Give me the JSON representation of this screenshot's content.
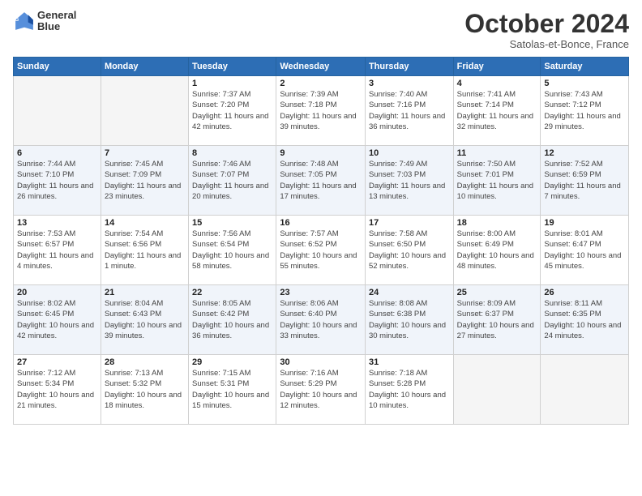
{
  "logo": {
    "line1": "General",
    "line2": "Blue"
  },
  "title": "October 2024",
  "location": "Satolas-et-Bonce, France",
  "headers": [
    "Sunday",
    "Monday",
    "Tuesday",
    "Wednesday",
    "Thursday",
    "Friday",
    "Saturday"
  ],
  "weeks": [
    [
      {
        "day": "",
        "empty": true
      },
      {
        "day": "",
        "empty": true
      },
      {
        "day": "1",
        "sunrise": "Sunrise: 7:37 AM",
        "sunset": "Sunset: 7:20 PM",
        "daylight": "Daylight: 11 hours and 42 minutes."
      },
      {
        "day": "2",
        "sunrise": "Sunrise: 7:39 AM",
        "sunset": "Sunset: 7:18 PM",
        "daylight": "Daylight: 11 hours and 39 minutes."
      },
      {
        "day": "3",
        "sunrise": "Sunrise: 7:40 AM",
        "sunset": "Sunset: 7:16 PM",
        "daylight": "Daylight: 11 hours and 36 minutes."
      },
      {
        "day": "4",
        "sunrise": "Sunrise: 7:41 AM",
        "sunset": "Sunset: 7:14 PM",
        "daylight": "Daylight: 11 hours and 32 minutes."
      },
      {
        "day": "5",
        "sunrise": "Sunrise: 7:43 AM",
        "sunset": "Sunset: 7:12 PM",
        "daylight": "Daylight: 11 hours and 29 minutes."
      }
    ],
    [
      {
        "day": "6",
        "sunrise": "Sunrise: 7:44 AM",
        "sunset": "Sunset: 7:10 PM",
        "daylight": "Daylight: 11 hours and 26 minutes."
      },
      {
        "day": "7",
        "sunrise": "Sunrise: 7:45 AM",
        "sunset": "Sunset: 7:09 PM",
        "daylight": "Daylight: 11 hours and 23 minutes."
      },
      {
        "day": "8",
        "sunrise": "Sunrise: 7:46 AM",
        "sunset": "Sunset: 7:07 PM",
        "daylight": "Daylight: 11 hours and 20 minutes."
      },
      {
        "day": "9",
        "sunrise": "Sunrise: 7:48 AM",
        "sunset": "Sunset: 7:05 PM",
        "daylight": "Daylight: 11 hours and 17 minutes."
      },
      {
        "day": "10",
        "sunrise": "Sunrise: 7:49 AM",
        "sunset": "Sunset: 7:03 PM",
        "daylight": "Daylight: 11 hours and 13 minutes."
      },
      {
        "day": "11",
        "sunrise": "Sunrise: 7:50 AM",
        "sunset": "Sunset: 7:01 PM",
        "daylight": "Daylight: 11 hours and 10 minutes."
      },
      {
        "day": "12",
        "sunrise": "Sunrise: 7:52 AM",
        "sunset": "Sunset: 6:59 PM",
        "daylight": "Daylight: 11 hours and 7 minutes."
      }
    ],
    [
      {
        "day": "13",
        "sunrise": "Sunrise: 7:53 AM",
        "sunset": "Sunset: 6:57 PM",
        "daylight": "Daylight: 11 hours and 4 minutes."
      },
      {
        "day": "14",
        "sunrise": "Sunrise: 7:54 AM",
        "sunset": "Sunset: 6:56 PM",
        "daylight": "Daylight: 11 hours and 1 minute."
      },
      {
        "day": "15",
        "sunrise": "Sunrise: 7:56 AM",
        "sunset": "Sunset: 6:54 PM",
        "daylight": "Daylight: 10 hours and 58 minutes."
      },
      {
        "day": "16",
        "sunrise": "Sunrise: 7:57 AM",
        "sunset": "Sunset: 6:52 PM",
        "daylight": "Daylight: 10 hours and 55 minutes."
      },
      {
        "day": "17",
        "sunrise": "Sunrise: 7:58 AM",
        "sunset": "Sunset: 6:50 PM",
        "daylight": "Daylight: 10 hours and 52 minutes."
      },
      {
        "day": "18",
        "sunrise": "Sunrise: 8:00 AM",
        "sunset": "Sunset: 6:49 PM",
        "daylight": "Daylight: 10 hours and 48 minutes."
      },
      {
        "day": "19",
        "sunrise": "Sunrise: 8:01 AM",
        "sunset": "Sunset: 6:47 PM",
        "daylight": "Daylight: 10 hours and 45 minutes."
      }
    ],
    [
      {
        "day": "20",
        "sunrise": "Sunrise: 8:02 AM",
        "sunset": "Sunset: 6:45 PM",
        "daylight": "Daylight: 10 hours and 42 minutes."
      },
      {
        "day": "21",
        "sunrise": "Sunrise: 8:04 AM",
        "sunset": "Sunset: 6:43 PM",
        "daylight": "Daylight: 10 hours and 39 minutes."
      },
      {
        "day": "22",
        "sunrise": "Sunrise: 8:05 AM",
        "sunset": "Sunset: 6:42 PM",
        "daylight": "Daylight: 10 hours and 36 minutes."
      },
      {
        "day": "23",
        "sunrise": "Sunrise: 8:06 AM",
        "sunset": "Sunset: 6:40 PM",
        "daylight": "Daylight: 10 hours and 33 minutes."
      },
      {
        "day": "24",
        "sunrise": "Sunrise: 8:08 AM",
        "sunset": "Sunset: 6:38 PM",
        "daylight": "Daylight: 10 hours and 30 minutes."
      },
      {
        "day": "25",
        "sunrise": "Sunrise: 8:09 AM",
        "sunset": "Sunset: 6:37 PM",
        "daylight": "Daylight: 10 hours and 27 minutes."
      },
      {
        "day": "26",
        "sunrise": "Sunrise: 8:11 AM",
        "sunset": "Sunset: 6:35 PM",
        "daylight": "Daylight: 10 hours and 24 minutes."
      }
    ],
    [
      {
        "day": "27",
        "sunrise": "Sunrise: 7:12 AM",
        "sunset": "Sunset: 5:34 PM",
        "daylight": "Daylight: 10 hours and 21 minutes."
      },
      {
        "day": "28",
        "sunrise": "Sunrise: 7:13 AM",
        "sunset": "Sunset: 5:32 PM",
        "daylight": "Daylight: 10 hours and 18 minutes."
      },
      {
        "day": "29",
        "sunrise": "Sunrise: 7:15 AM",
        "sunset": "Sunset: 5:31 PM",
        "daylight": "Daylight: 10 hours and 15 minutes."
      },
      {
        "day": "30",
        "sunrise": "Sunrise: 7:16 AM",
        "sunset": "Sunset: 5:29 PM",
        "daylight": "Daylight: 10 hours and 12 minutes."
      },
      {
        "day": "31",
        "sunrise": "Sunrise: 7:18 AM",
        "sunset": "Sunset: 5:28 PM",
        "daylight": "Daylight: 10 hours and 10 minutes."
      },
      {
        "day": "",
        "empty": true
      },
      {
        "day": "",
        "empty": true
      }
    ]
  ]
}
